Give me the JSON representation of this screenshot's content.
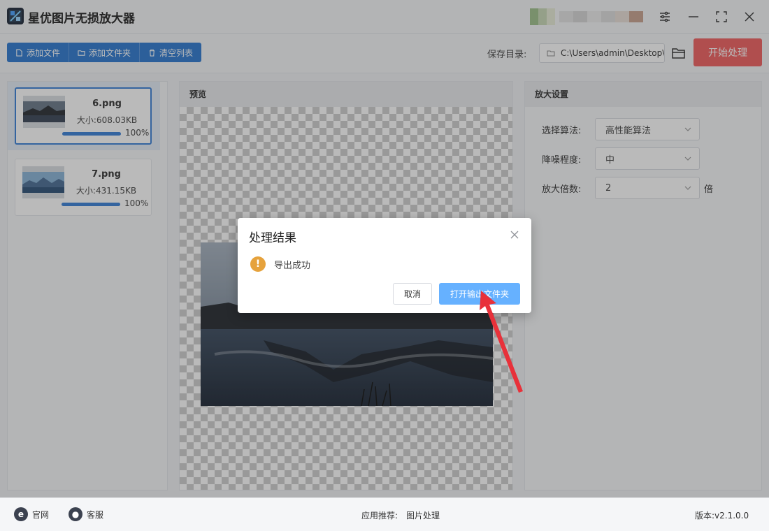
{
  "app": {
    "title": "星优图片无损放大器"
  },
  "toolbar": {
    "add_file": "添加文件",
    "add_folder": "添加文件夹",
    "clear_list": "清空列表",
    "save_dir_label": "保存目录:",
    "save_dir_value": "C:\\Users\\admin\\Desktop\\",
    "start_label": "开始处理"
  },
  "files": [
    {
      "name": "6.png",
      "size": "大小:608.03KB",
      "progress_label": "100%",
      "progress": 1.0,
      "selected": true
    },
    {
      "name": "7.png",
      "size": "大小:431.15KB",
      "progress_label": "100%",
      "progress": 1.0,
      "selected": false
    }
  ],
  "preview": {
    "title": "预览"
  },
  "settings": {
    "title": "放大设置",
    "algorithm_label": "选择算法:",
    "algorithm_value": "高性能算法",
    "denoise_label": "降噪程度:",
    "denoise_value": "中",
    "scale_label": "放大倍数:",
    "scale_value": "2",
    "scale_unit": "倍"
  },
  "dialog": {
    "title": "处理结果",
    "message": "导出成功",
    "cancel_label": "取消",
    "ok_label": "打开输出文件夹"
  },
  "footer": {
    "website": "官网",
    "support": "客服",
    "recommend_label": "应用推荐:",
    "recommend_value": "图片处理",
    "version": "版本:v2.1.0.0"
  },
  "colors": {
    "primary": "#2e7ad0",
    "start": "#f06060",
    "dialog_ok": "#66b1ff",
    "warning": "#e6a23c",
    "arrow": "#e8313a"
  },
  "icons": {
    "settings": "sliders-icon",
    "minimize": "minimize-icon",
    "maximize": "maximize-icon",
    "close": "close-icon",
    "folder": "folder-icon",
    "warning": "exclamation-icon"
  }
}
